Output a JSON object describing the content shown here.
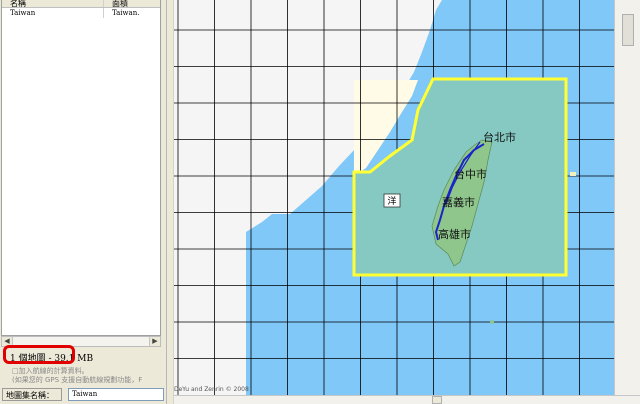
{
  "list": {
    "headers": [
      "名稱",
      "面積"
    ],
    "rows": [
      [
        "Taiwan",
        "Taiwan."
      ]
    ]
  },
  "status": {
    "map_count": "1 個地圖 - 39.1 MB",
    "hint_line1": "□加入航線的計算資料。",
    "hint_line2": "(如果您的 GPS 支援自動航線規劃功能，F"
  },
  "map_set": {
    "label": "地圖集名稱：",
    "value": "Taiwan"
  },
  "map": {
    "cities": [
      "台北市",
      "台中市",
      "嘉義市",
      "高雄市"
    ],
    "water_label": "洋",
    "copyright": "DeYu and Zenrin © 2008",
    "colors": {
      "sea": "#7fc8f8",
      "land": "#f5f5f5",
      "selection": "#ffff33",
      "selected_fill": "#86c9c2",
      "island": "#8ec68c",
      "route": "#1a24c8",
      "grid": "#000000",
      "highlight": "#e00000"
    }
  },
  "icons": [
    "scroll-left-icon",
    "scroll-right-icon"
  ]
}
